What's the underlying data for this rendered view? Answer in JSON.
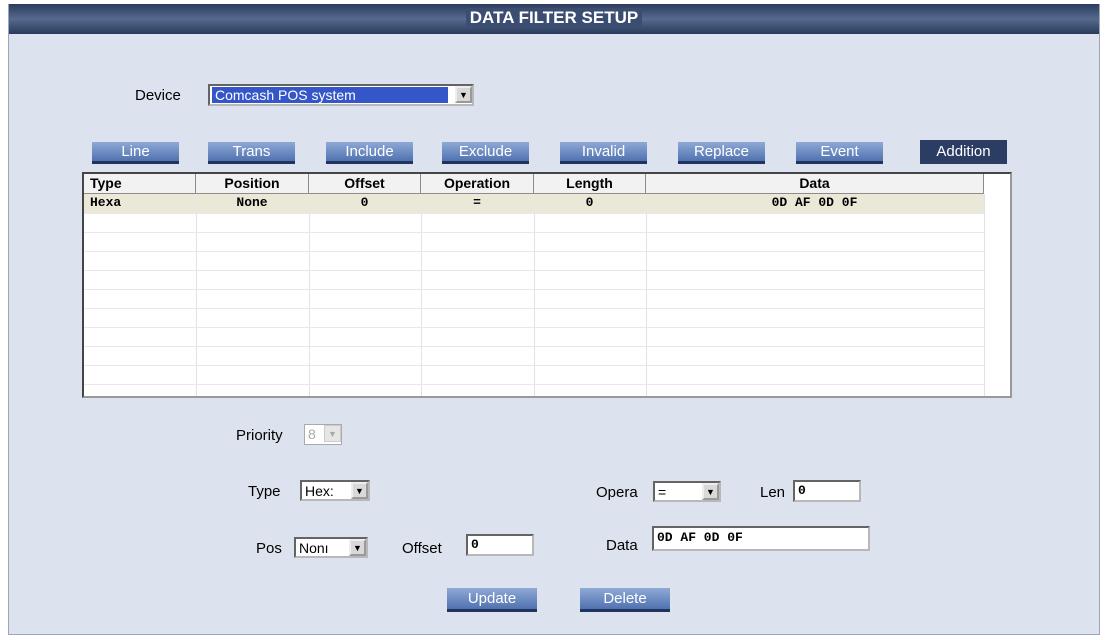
{
  "window": {
    "title": "DATA FILTER SETUP"
  },
  "device": {
    "label": "Device",
    "selected": "Comcash POS system"
  },
  "toolbar": {
    "buttons": [
      {
        "label": "Line"
      },
      {
        "label": "Trans"
      },
      {
        "label": "Include"
      },
      {
        "label": "Exclude"
      },
      {
        "label": "Invalid"
      },
      {
        "label": "Replace"
      },
      {
        "label": "Event"
      },
      {
        "label": "Addition",
        "active": true
      }
    ]
  },
  "table": {
    "columns": [
      "Type",
      "Position",
      "Offset",
      "Operation",
      "Length",
      "Data"
    ],
    "rows": [
      {
        "type": "Hexa",
        "position": "None",
        "offset": "0",
        "operation": "=",
        "length": "0",
        "data": "0D AF 0D 0F"
      }
    ]
  },
  "form": {
    "priority": {
      "label": "Priority",
      "value": "8"
    },
    "type": {
      "label": "Type",
      "value": "Hex:"
    },
    "pos": {
      "label": "Pos",
      "value": "Nonı"
    },
    "offset": {
      "label": "Offset",
      "value": "0"
    },
    "opera": {
      "label": "Opera",
      "value": "="
    },
    "len": {
      "label": "Len",
      "value": "0"
    },
    "data": {
      "label": "Data",
      "value": "0D AF 0D 0F"
    }
  },
  "actions": {
    "update": "Update",
    "delete": "Delete"
  },
  "colors": {
    "panel": "#dde3ee",
    "button": "#5072b0",
    "titlebar": "#3b4d70",
    "selected_row": "#ece8d8"
  }
}
